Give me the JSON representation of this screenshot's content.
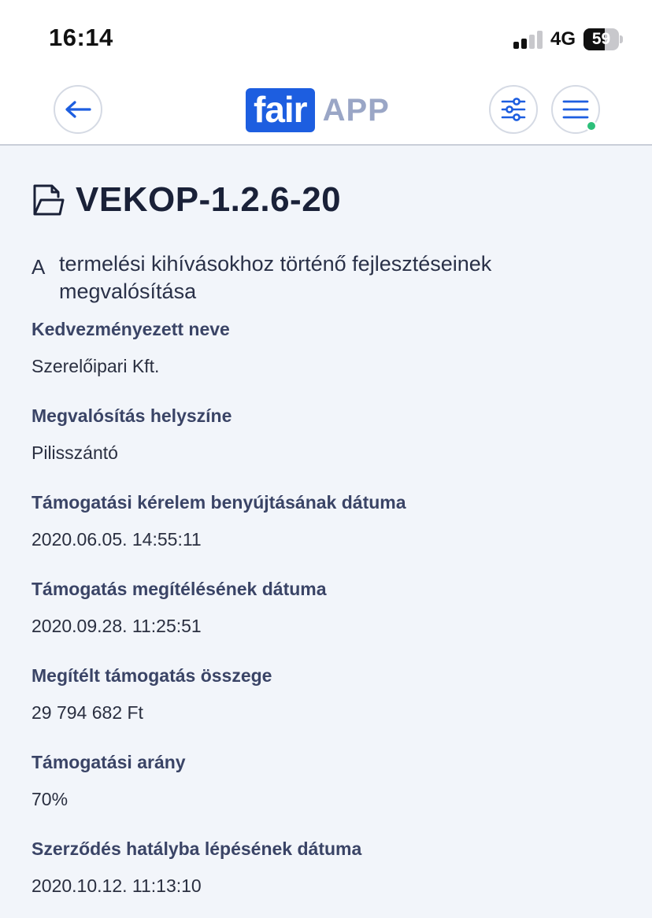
{
  "status_bar": {
    "time": "16:14",
    "network": "4G",
    "battery_level": "59",
    "signal_bars_active": 2,
    "signal_bars_total": 4
  },
  "app_bar": {
    "logo_boxed": "fair",
    "logo_text": "APP",
    "back_icon": "arrow-left-icon",
    "filter_icon": "sliders-icon",
    "menu_icon": "hamburger-menu-icon",
    "notification_dot": true
  },
  "project": {
    "icon": "document-icon",
    "id": "VEKOP-1.2.6-20",
    "desc_prefix": "A",
    "description": "termelési kihívásokhoz történő fejlesztéseinek megvalósítása"
  },
  "fields": [
    {
      "label": "Kedvezményezett neve",
      "value": "Szerelőipari Kft."
    },
    {
      "label": "Megvalósítás helyszíne",
      "value": "Pilisszántó"
    },
    {
      "label": "Támogatási kérelem benyújtásának dátuma",
      "value": "2020.06.05. 14:55:11"
    },
    {
      "label": "Támogatás megítélésének dátuma",
      "value": "2020.09.28. 11:25:51"
    },
    {
      "label": "Megítélt támogatás összege",
      "value": "29 794 682 Ft"
    },
    {
      "label": "Támogatási arány",
      "value": "70%"
    },
    {
      "label": "Szerződés hatályba lépésének dátuma",
      "value": "2020.10.12. 11:13:10"
    }
  ],
  "colors": {
    "brand_blue": "#1d5ee0",
    "logo_grey": "#9aa6c6",
    "background": "#f2f5fa",
    "notification_green": "#2dbf7a"
  }
}
